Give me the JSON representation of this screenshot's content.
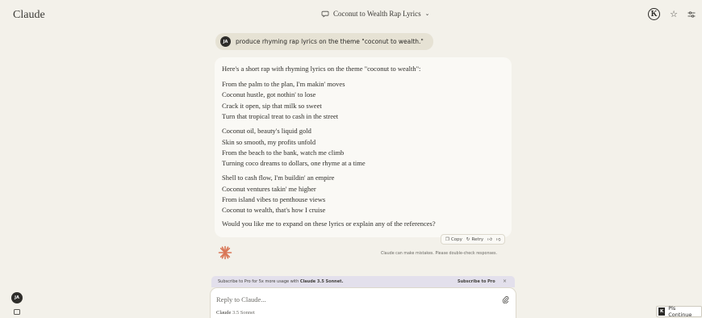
{
  "app": {
    "brand": "Claude"
  },
  "header": {
    "conversation_title": "Coconut to Wealth Rap Lyrics",
    "account_initial": "K",
    "icons": [
      "chat-icon",
      "chevron-down-icon",
      "star-icon",
      "settings-sliders-icon"
    ]
  },
  "user_message": {
    "avatar_initials": "JA",
    "text": "produce rhyming rap lyrics on the theme \"coconut to wealth.\""
  },
  "assistant_message": {
    "intro": "Here's a short rap with rhyming lyrics on the theme \"coconut to wealth\":",
    "stanzas": [
      [
        "From the palm to the plan, I'm makin' moves",
        "Coconut hustle, got nothin' to lose",
        "Crack it open, sip that milk so sweet",
        "Turn that tropical treat to cash in the street"
      ],
      [
        "Coconut oil, beauty's liquid gold",
        "Skin so smooth, my profits unfold",
        "From the beach to the bank, watch me climb",
        "Turning coco dreams to dollars, one rhyme at a time"
      ],
      [
        "Shell to cash flow, I'm buildin' an empire",
        "Coconut ventures takin' me higher",
        "From island vibes to penthouse views",
        "Coconut to wealth, that's how I cruise"
      ]
    ],
    "outro": "Would you like me to expand on these lyrics or explain any of the references?",
    "actions": {
      "copy": "Copy",
      "retry": "Retry"
    }
  },
  "disclaimer": "Claude can make mistakes. Please double-check responses.",
  "promo": {
    "text_prefix": "Subscribe to Pro for 5x more usage with ",
    "text_bold": "Claude 3.5 Sonnet.",
    "link": "Subscribe to Pro",
    "close": "×"
  },
  "composer": {
    "placeholder": "Reply to Claude...",
    "model_name": "Claude",
    "model_version": "3.5 Sonnet"
  },
  "sidebar": {
    "avatar_initials": "JA"
  },
  "extension_button": {
    "icon_letter": "K",
    "label": "Pls Continue"
  },
  "colors": {
    "background": "#f3f1ea",
    "accent_spark": "#d97757",
    "avatar": "#2e2d2a"
  }
}
